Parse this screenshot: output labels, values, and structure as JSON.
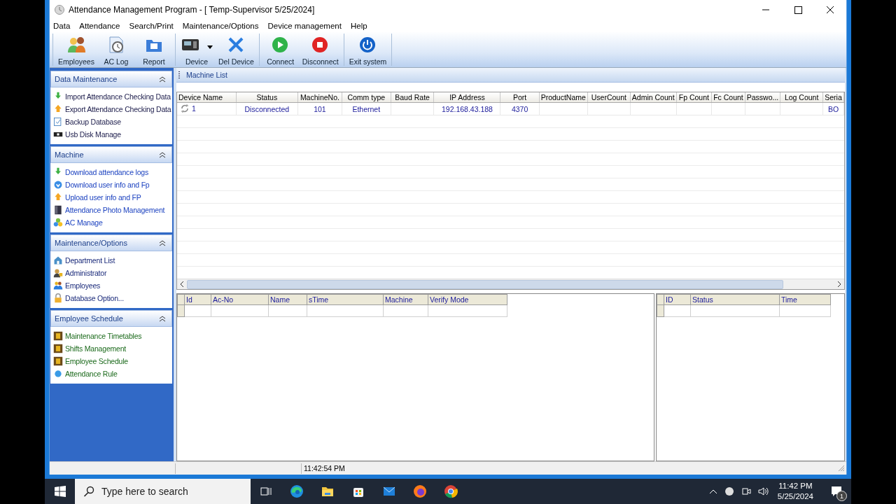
{
  "window": {
    "title": "Attendance Management Program - [ Temp-Supervisor 5/25/2024]"
  },
  "menu": [
    "Data",
    "Attendance",
    "Search/Print",
    "Maintenance/Options",
    "Device management",
    "Help"
  ],
  "toolbar": {
    "groups": [
      [
        {
          "label": "Employees",
          "dropdown": false
        },
        {
          "label": "AC Log",
          "dropdown": false
        },
        {
          "label": "Report",
          "dropdown": false
        }
      ],
      [
        {
          "label": "Device",
          "dropdown": true
        },
        {
          "label": "Del Device",
          "dropdown": false
        }
      ],
      [
        {
          "label": "Connect",
          "dropdown": false
        },
        {
          "label": "Disconnect",
          "dropdown": false
        }
      ],
      [
        {
          "label": "Exit system",
          "dropdown": false
        }
      ]
    ]
  },
  "sidebar": {
    "panels": [
      {
        "title": "Data Maintenance",
        "expanded": true,
        "items": [
          "Import Attendance Checking Data",
          "Export Attendance Checking Data",
          "Backup Database",
          "Usb Disk Manage"
        ]
      },
      {
        "title": "Machine",
        "expanded": true,
        "items": [
          "Download attendance logs",
          "Download user info and Fp",
          "Upload user info and FP",
          "Attendance Photo Management",
          "AC Manage"
        ]
      },
      {
        "title": "Maintenance/Options",
        "expanded": true,
        "items": [
          "Department List",
          "Administrator",
          "Employees",
          "Database Option..."
        ]
      },
      {
        "title": "Employee Schedule",
        "expanded": true,
        "items": [
          "Maintenance Timetables",
          "Shifts Management",
          "Employee Schedule",
          "Attendance Rule"
        ]
      }
    ]
  },
  "machine_list": {
    "title": "Machine List",
    "columns": [
      "Device Name",
      "Status",
      "MachineNo.",
      "Comm type",
      "Baud Rate",
      "IP Address",
      "Port",
      "ProductName",
      "UserCount",
      "Admin Count",
      "Fp Count",
      "Fc Count",
      "Passwo...",
      "Log Count",
      "Seria"
    ],
    "rows": [
      [
        "1",
        "Disconnected",
        "101",
        "Ethernet",
        "",
        "192.168.43.188",
        "4370",
        "",
        "",
        "",
        "",
        "",
        "",
        "",
        "BO"
      ]
    ]
  },
  "log_grid": {
    "columns": [
      "Id",
      "Ac-No",
      "Name",
      "sTime",
      "Machine",
      "Verify Mode"
    ]
  },
  "status_grid": {
    "columns": [
      "ID",
      "Status",
      "Time"
    ]
  },
  "status_bar": {
    "time": "11:42:54 PM"
  },
  "taskbar": {
    "search_placeholder": "Type here to search",
    "time": "11:42 PM",
    "date": "5/25/2024",
    "notifications": "1"
  }
}
